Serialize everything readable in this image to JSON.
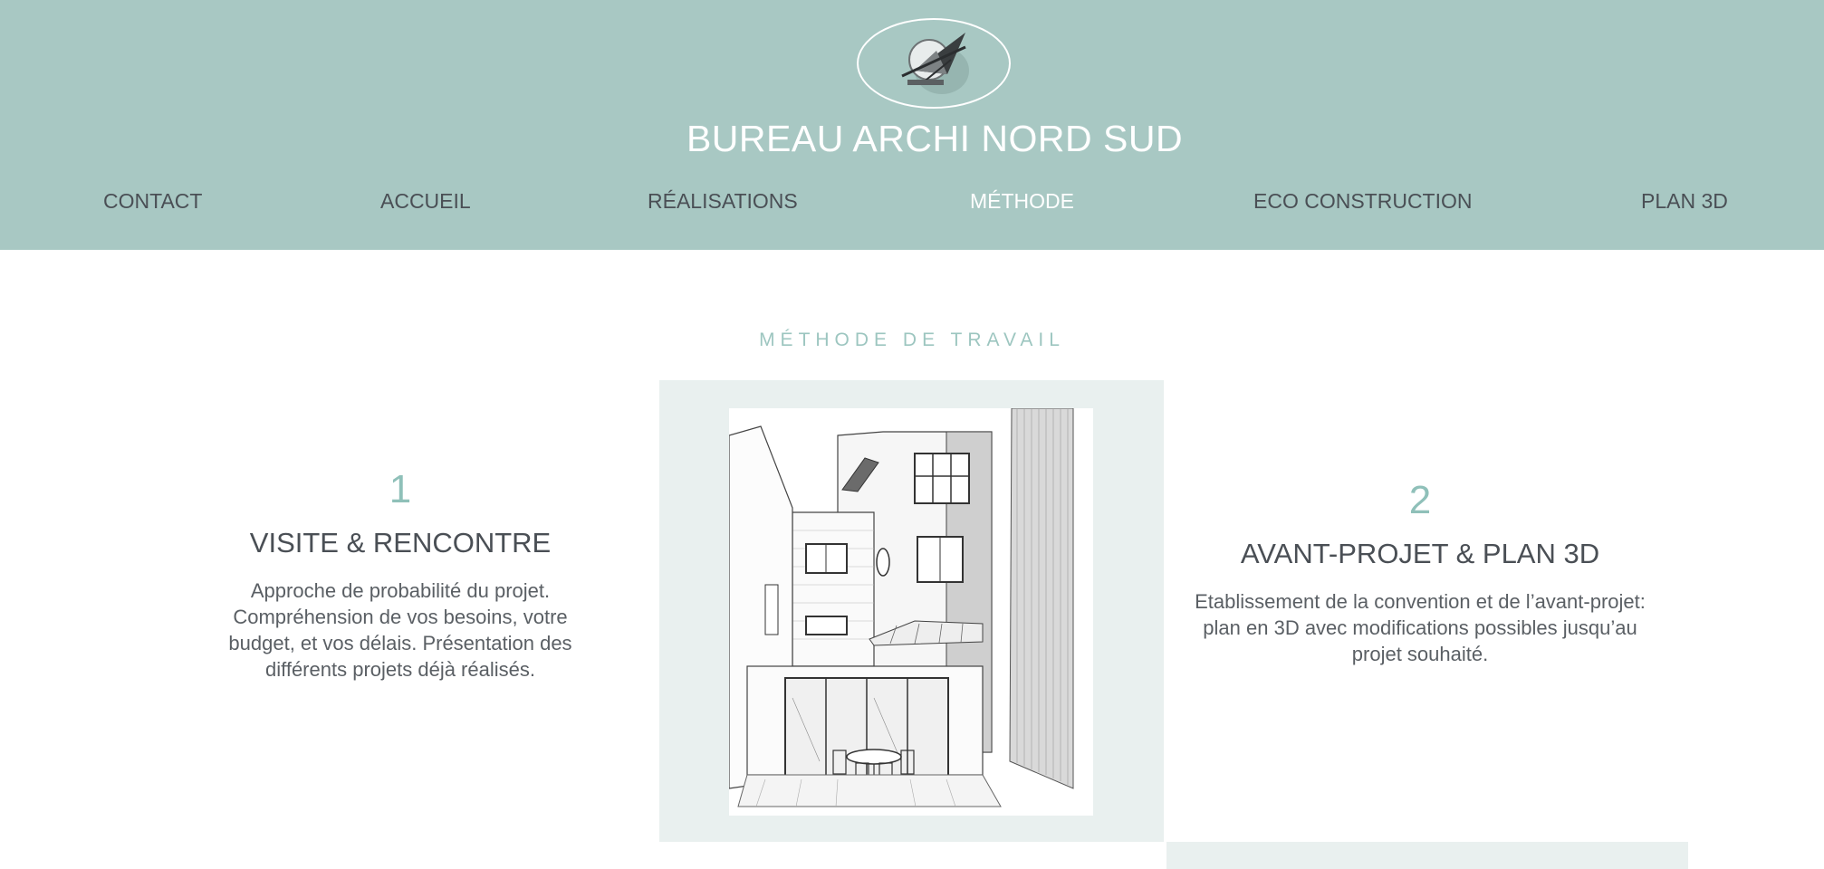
{
  "header": {
    "site_title": "BUREAU ARCHI NORD SUD",
    "logo_icon": "architect-compass-logo-icon",
    "background_color": "#a8c8c3"
  },
  "nav": {
    "items": [
      {
        "label": "CONTACT"
      },
      {
        "label": "ACCUEIL"
      },
      {
        "label": "RÉALISATIONS"
      },
      {
        "label": "MÉTHODE",
        "active": true
      },
      {
        "label": "ECO CONSTRUCTION"
      },
      {
        "label": "PLAN 3D"
      }
    ]
  },
  "main": {
    "section_title": "MÉTHODE DE TRAVAIL",
    "steps": [
      {
        "number": "1",
        "title": "VISITE & RENCONTRE",
        "text": "Approche de probabilité du projet. Compréhension de vos besoins, votre budget, et vos délais. Présentation des différents projets déjà réalisés."
      },
      {
        "number": "2",
        "title": "AVANT-PROJET & PLAN 3D",
        "text": "Etablissement de la convention et de l’avant-projet: plan en 3D avec modifications possibles jusqu’au projet souhaité."
      }
    ],
    "image_icon": "house-sketch-image",
    "accent_color": "#9dc6c0"
  }
}
